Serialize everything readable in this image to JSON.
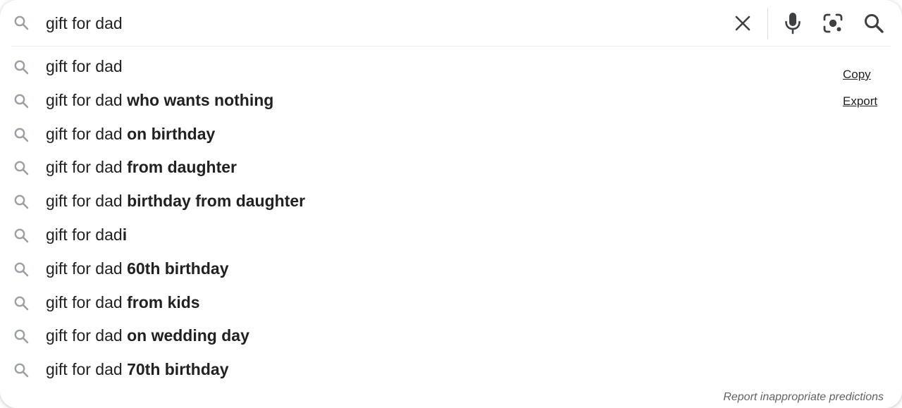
{
  "search": {
    "value": "gift for dad",
    "icon": "search-icon"
  },
  "toolbar": {
    "clear_icon": "close-icon",
    "voice_icon": "mic-icon",
    "lens_icon": "camera-lens-icon",
    "submit_icon": "search-icon"
  },
  "suggestions": [
    {
      "prefix": "gift for dad",
      "completion": ""
    },
    {
      "prefix": "gift for dad ",
      "completion": "who wants nothing"
    },
    {
      "prefix": "gift for dad ",
      "completion": "on birthday"
    },
    {
      "prefix": "gift for dad ",
      "completion": "from daughter"
    },
    {
      "prefix": "gift for dad ",
      "completion": "birthday from daughter"
    },
    {
      "prefix": "gift for dad",
      "completion": "i"
    },
    {
      "prefix": "gift for dad ",
      "completion": "60th birthday"
    },
    {
      "prefix": "gift for dad ",
      "completion": "from kids"
    },
    {
      "prefix": "gift for dad ",
      "completion": "on wedding day"
    },
    {
      "prefix": "gift for dad ",
      "completion": "70th birthday"
    }
  ],
  "actions": {
    "copy": "Copy",
    "export": "Export"
  },
  "footer": {
    "report": "Report inappropriate predictions"
  },
  "colors": {
    "text": "#202124",
    "icon": "#9aa0a6",
    "toolbar_icon": "#3c4043",
    "divider": "#dadce0"
  }
}
